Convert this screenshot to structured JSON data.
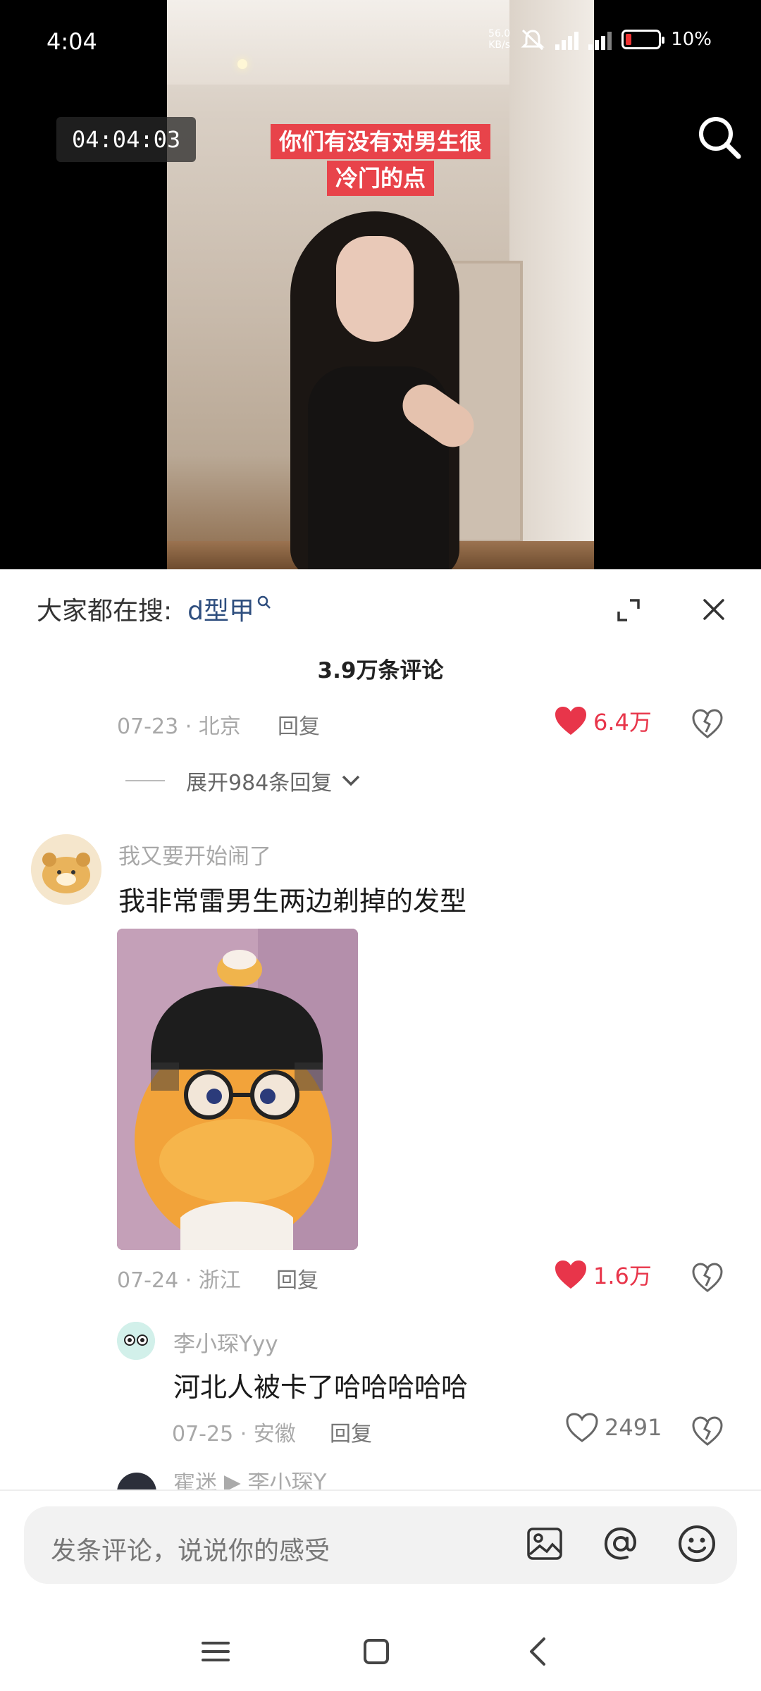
{
  "status_bar": {
    "time": "4:04",
    "net_speed_value": "56.0",
    "net_speed_unit": "KB/s",
    "battery_percent": "10%",
    "battery_level": 0.1
  },
  "video": {
    "timer": "04:04:03",
    "caption_line1": "你们有没有对男生很",
    "caption_line2": "冷门的点"
  },
  "sheet": {
    "trending_label": "大家都在搜:",
    "trending_keyword": "d型甲",
    "comment_count": "3.9万条评论"
  },
  "comments": {
    "first": {
      "meta": "07-23 · 北京",
      "reply": "回复",
      "likes": "6.4万",
      "expand_replies": "展开984条回复"
    },
    "second": {
      "username": "我又要开始闹了",
      "text": "我非常雷男生两边剃掉的发型",
      "meta": "07-24 · 浙江",
      "reply": "回复",
      "likes": "1.6万"
    },
    "reply1": {
      "username": "李小琛Yyy",
      "text": "河北人被卡了哈哈哈哈哈",
      "meta": "07-25 · 安徽",
      "reply": "回复",
      "likes": "2491"
    },
    "peek": {
      "text": "霍迷 ▶ 李小琛Y"
    }
  },
  "input_bar": {
    "placeholder": "发条评论，说说你的感受"
  },
  "colors": {
    "like_red": "#e8354a",
    "caption_bg": "#e8434a"
  }
}
